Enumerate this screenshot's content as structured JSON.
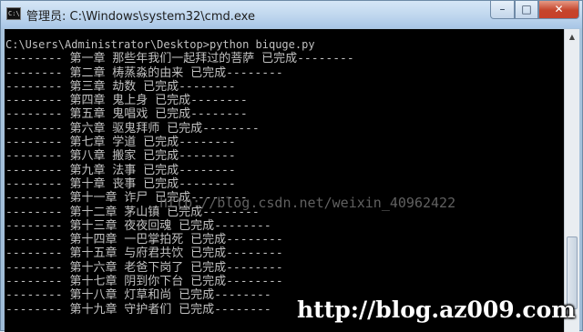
{
  "window": {
    "title": "管理员: C:\\Windows\\system32\\cmd.exe",
    "app_icon_text": "C:\\",
    "buttons": {
      "minimize": "–",
      "maximize": "□",
      "close": "✕"
    }
  },
  "console": {
    "lines": [
      "C:\\Users\\Administrator\\Desktop>python biquge.py",
      "-------- 第一章 那些年我们一起拜过的菩萨 已完成--------",
      "-------- 第二章 梼蒸淼的由来 已完成--------",
      "-------- 第三章 劫数 已完成--------",
      "-------- 第四章 鬼上身 已完成--------",
      "-------- 第五章 鬼唱戏 已完成--------",
      "-------- 第六章 驱鬼拜师 已完成--------",
      "-------- 第七章 学道 已完成--------",
      "-------- 第八章 搬家 已完成--------",
      "-------- 第九章 法事 已完成--------",
      "-------- 第十章 丧事 已完成--------",
      "-------- 第十一章 诈尸 已完成--------",
      "-------- 第十二章 茅山镇 已完成--------",
      "-------- 第十三章 夜夜回魂 已完成--------",
      "-------- 第十四章 一巴掌拍死 已完成--------",
      "-------- 第十五章 与府君共饮 已完成--------",
      "-------- 第十六章 老爸下岗了 已完成--------",
      "-------- 第十七章 阴到你下台 已完成--------",
      "-------- 第十八章 灯草和尚 已完成--------",
      "-------- 第十九章 守护者们 已完成--------"
    ]
  },
  "watermarks": {
    "blog": "http://blog.csdn.net/weixin_40962422",
    "site": "http://blog.az009.com"
  }
}
